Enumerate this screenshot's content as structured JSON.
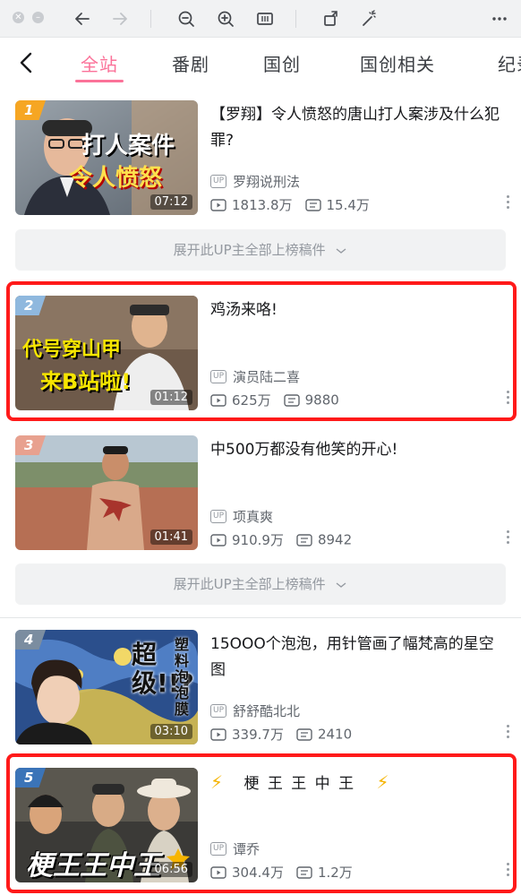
{
  "toolbar": {
    "icons": [
      "close-icon",
      "minimize-icon",
      "back-arrow-icon",
      "forward-arrow-icon",
      "zoom-out-icon",
      "zoom-in-icon",
      "reader-icon",
      "rotate-icon",
      "magic-wand-icon",
      "more-icon"
    ]
  },
  "tabs": [
    {
      "label": "全站",
      "active": true
    },
    {
      "label": "番剧"
    },
    {
      "label": "国创"
    },
    {
      "label": "国创相关"
    },
    {
      "label": "纪录"
    }
  ],
  "accent_color": "#fb7299",
  "highlight_color": "#ff1a1a",
  "items": [
    {
      "rank": "1",
      "title": "【罗翔】令人愤怒的唐山打人案涉及什么犯罪?",
      "duration": "07:12",
      "uploader": "罗翔说刑法",
      "views": "1813.8万",
      "danmaku": "15.4万",
      "cover_text": [
        "打人案件",
        "令人愤怒"
      ],
      "expand_label": "展开此UP主全部上榜稿件"
    },
    {
      "rank": "2",
      "title": "鸡汤来咯!",
      "duration": "01:12",
      "uploader": "演员陆二喜",
      "views": "625万",
      "danmaku": "9880",
      "cover_text": [
        "代号穿山甲",
        "来B站啦!"
      ]
    },
    {
      "rank": "3",
      "title": "中500万都没有他笑的开心!",
      "duration": "01:41",
      "uploader": "项真爽",
      "views": "910.9万",
      "danmaku": "8942",
      "expand_label": "展开此UP主全部上榜稿件"
    },
    {
      "rank": "4",
      "title": "15OOO个泡泡，用针管画了幅梵高的星空图",
      "duration": "03:10",
      "uploader": "舒舒酷北北",
      "views": "339.7万",
      "danmaku": "2410",
      "cover_text": [
        "超级!!?",
        "塑料泡泡膜"
      ]
    },
    {
      "rank": "5",
      "title": "梗 王 王 中 王",
      "duration": "06:56",
      "uploader": "谭乔",
      "views": "304.4万",
      "danmaku": "1.2万",
      "cover_text": [
        "梗王王中王"
      ]
    }
  ],
  "up_tag": "UP"
}
